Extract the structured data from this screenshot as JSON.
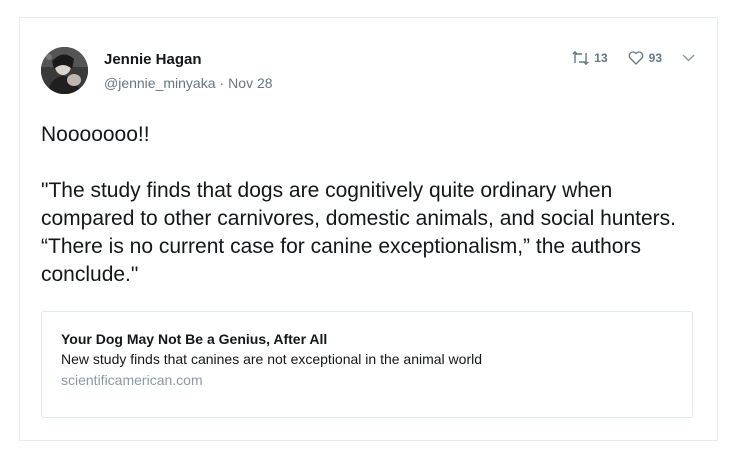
{
  "tweet": {
    "author": {
      "display_name": "Jennie Hagan",
      "handle": "@jennie_minyaka",
      "date": "Nov 28",
      "separator": "·",
      "avatar_icon": "user-avatar"
    },
    "actions": {
      "retweet_icon": "retweet-icon",
      "retweet_count": "13",
      "like_icon": "heart-icon",
      "like_count": "93",
      "more_icon": "chevron-down-icon"
    },
    "text": {
      "line1": "Nooooooo!!",
      "quote": "\"The study finds that dogs are cognitively quite ordinary when compared to other carnivores, domestic animals, and social hunters. “There is no current case for canine exceptionalism,” the authors conclude.\""
    },
    "link_card": {
      "title": "Your Dog May Not Be a Genius, After All",
      "description": "New study finds that canines are not exceptional in the animal world",
      "domain": "scientificamerican.com"
    }
  },
  "colors": {
    "text_primary": "#14171a",
    "text_secondary": "#657786",
    "border": "#e6ecf0",
    "domain": "#8899a6"
  }
}
